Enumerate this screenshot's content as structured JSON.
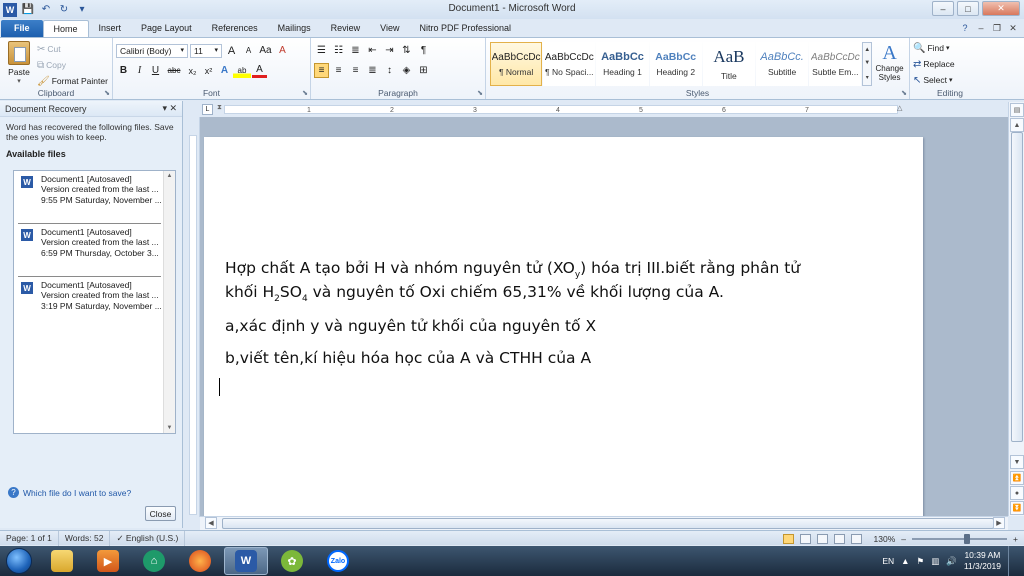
{
  "window": {
    "title": "Document1 - Microsoft Word",
    "controls": {
      "minimize": "–",
      "maximize": "□",
      "close": "✕"
    }
  },
  "qat": {
    "word_icon": "W",
    "save": "💾",
    "undo": "↶",
    "redo": "↻",
    "customize": "▾"
  },
  "tabs": [
    {
      "label": "File"
    },
    {
      "label": "Home"
    },
    {
      "label": "Insert"
    },
    {
      "label": "Page Layout"
    },
    {
      "label": "References"
    },
    {
      "label": "Mailings"
    },
    {
      "label": "Review"
    },
    {
      "label": "View"
    },
    {
      "label": "Nitro PDF Professional"
    }
  ],
  "ribbon": {
    "clipboard": {
      "label": "Clipboard",
      "paste": "Paste",
      "cut": "Cut",
      "copy": "Copy",
      "format_painter": "Format Painter"
    },
    "font": {
      "label": "Font",
      "font_name": "Calibri (Body)",
      "font_size": "11",
      "grow": "A",
      "shrink": "A",
      "change_case": "Aa",
      "clear": "A",
      "bold": "B",
      "italic": "I",
      "underline": "U",
      "strike": "abc",
      "subscript": "x₂",
      "superscript": "x²",
      "effects": "A",
      "highlight": "ab",
      "color": "A"
    },
    "paragraph": {
      "label": "Paragraph",
      "pilcrow": "¶"
    },
    "styles": {
      "label": "Styles",
      "change_styles": "Change Styles",
      "items": [
        {
          "preview": "AaBbCcDc",
          "name": "¶ Normal"
        },
        {
          "preview": "AaBbCcDc",
          "name": "¶ No Spaci..."
        },
        {
          "preview": "AaBbCc",
          "name": "Heading 1"
        },
        {
          "preview": "AaBbCc",
          "name": "Heading 2"
        },
        {
          "preview": "AaB",
          "name": "Title"
        },
        {
          "preview": "AaBbCc.",
          "name": "Subtitle"
        },
        {
          "preview": "AaBbCcDc",
          "name": "Subtle Em..."
        }
      ]
    },
    "editing": {
      "label": "Editing",
      "find": "Find",
      "replace": "Replace",
      "select": "Select"
    }
  },
  "recovery": {
    "title": "Document Recovery",
    "message": "Word has recovered the following files.  Save the ones you wish to keep.",
    "available": "Available files",
    "files": [
      {
        "name": "Document1  [Autosaved]",
        "desc": "Version created from the last ...",
        "time": "9:55 PM Saturday, November ..."
      },
      {
        "name": "Document1  [Autosaved]",
        "desc": "Version created from the last ...",
        "time": "6:59 PM Thursday, October 3..."
      },
      {
        "name": "Document1  [Autosaved]",
        "desc": "Version created from the last ...",
        "time": "3:19 PM Saturday, November ..."
      }
    ],
    "help": "Which file do I want to save?",
    "close": "Close"
  },
  "document": {
    "line1_a": "Hợp chất A tạo bởi H và nhóm nguyên tử (XO",
    "line1_sub": "y",
    "line1_b": ") hóa trị III.biết rằng phân tử",
    "line2_a": "khối H",
    "line2_sub1": "2",
    "line2_b": "SO",
    "line2_sub2": "4",
    "line2_c": " và nguyên tố Oxi chiếm 65,31% về khối lượng của A.",
    "line3": "a,xác định y và nguyên tử khối của nguyên tố X",
    "line4": "b,viết tên,kí hiệu hóa học của A và CTHH của A"
  },
  "status": {
    "page": "Page: 1 of 1",
    "words": "Words: 52",
    "language": "English (U.S.)",
    "zoom": "130%",
    "zoom_out": "–",
    "zoom_in": "+"
  },
  "taskbar": {
    "word_label": "W",
    "zalo_label": "Zalo",
    "lang": "EN",
    "time": "10:39 AM",
    "date": "11/3/2019"
  }
}
